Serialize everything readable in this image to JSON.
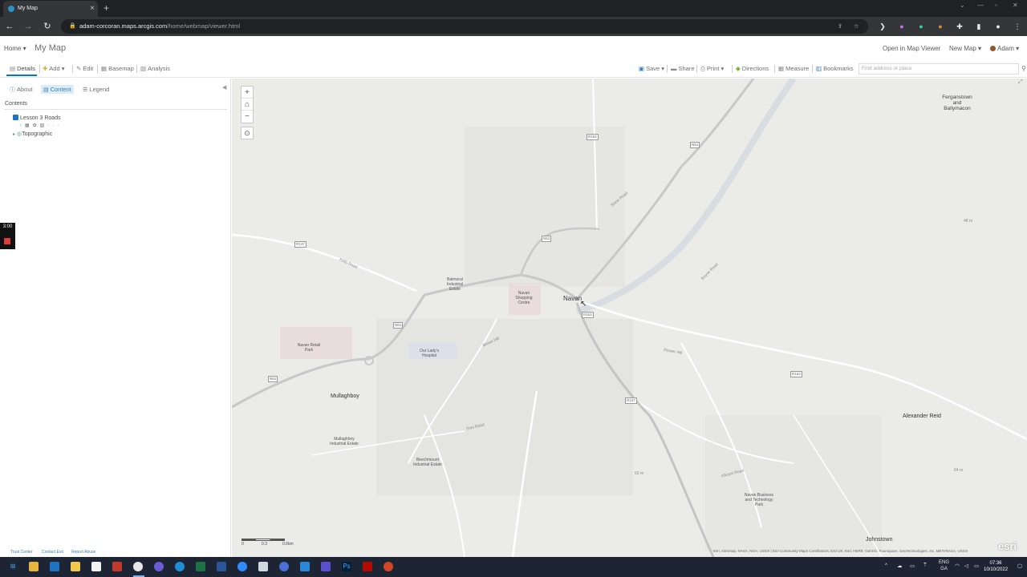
{
  "browser": {
    "tab_title": "My Map",
    "url_host": "adam-corcoran.maps.arcgis.com",
    "url_path": "/home/webmap/viewer.html"
  },
  "header": {
    "home_label": "Home",
    "map_title": "My Map",
    "open_in_viewer": "Open in Map Viewer",
    "new_map": "New Map",
    "user": "Adam"
  },
  "toolbar": {
    "details": "Details",
    "add": "Add",
    "edit": "Edit",
    "basemap": "Basemap",
    "analysis": "Analysis",
    "save": "Save",
    "share": "Share",
    "print": "Print",
    "directions": "Directions",
    "measure": "Measure",
    "bookmarks": "Bookmarks",
    "search_placeholder": "Find address or place"
  },
  "panel": {
    "tabs": [
      "About",
      "Content",
      "Legend"
    ],
    "contents_header": "Contents",
    "layers": [
      "Lesson 3 Roads",
      "Topographic"
    ],
    "footer_links": [
      "Trust Center",
      "Contact Esri",
      "Report Abuse"
    ]
  },
  "recorder": {
    "time": "3:00"
  },
  "map": {
    "places": {
      "navan": "Navan",
      "mullaghboy": "Mullaghboy",
      "alexander_reid": "Alexander Reid",
      "johnstown": "Johnstown",
      "ferganstown": "Ferganstown and Ballymacon",
      "balmoral": "Balmoral Industrial Estate",
      "navan_shopping": "Navan Shopping Centre",
      "navan_retail": "Navan Retail Park",
      "hospital": "Our Lady's Hospital",
      "mullaghboy_estate": "Mullaghboy Industrial Estate",
      "beechmount": "Beechmount Industrial Estate",
      "business_park": "Navan Business and Technology Park"
    },
    "roads": [
      "Kells Road",
      "Slane Road",
      "Brews Hill",
      "Flower Hill",
      "Boyne Road",
      "Trim Road",
      "Kilcarn Road"
    ],
    "shields": [
      "R162",
      "N51",
      "R147",
      "N51",
      "N51",
      "R153",
      "R147",
      "R153",
      "N51"
    ],
    "elevations": [
      "48 m",
      "52 m",
      "64 m"
    ],
    "scale_labels": [
      "0",
      "0.3",
      "0.6km"
    ],
    "attribution": "Esri, Intermap, NASA, NGA, USGS | Esri Community Maps Contributors, Esri UK, Esri, HERE, Garmin, Foursquare, GeoTechnologies, Inc, METI/NASA, USGS",
    "logo": "esri"
  },
  "taskbar": {
    "lang_line1": "ENG",
    "lang_line2": "GA",
    "time": "07:36",
    "date": "10/10/2022"
  }
}
